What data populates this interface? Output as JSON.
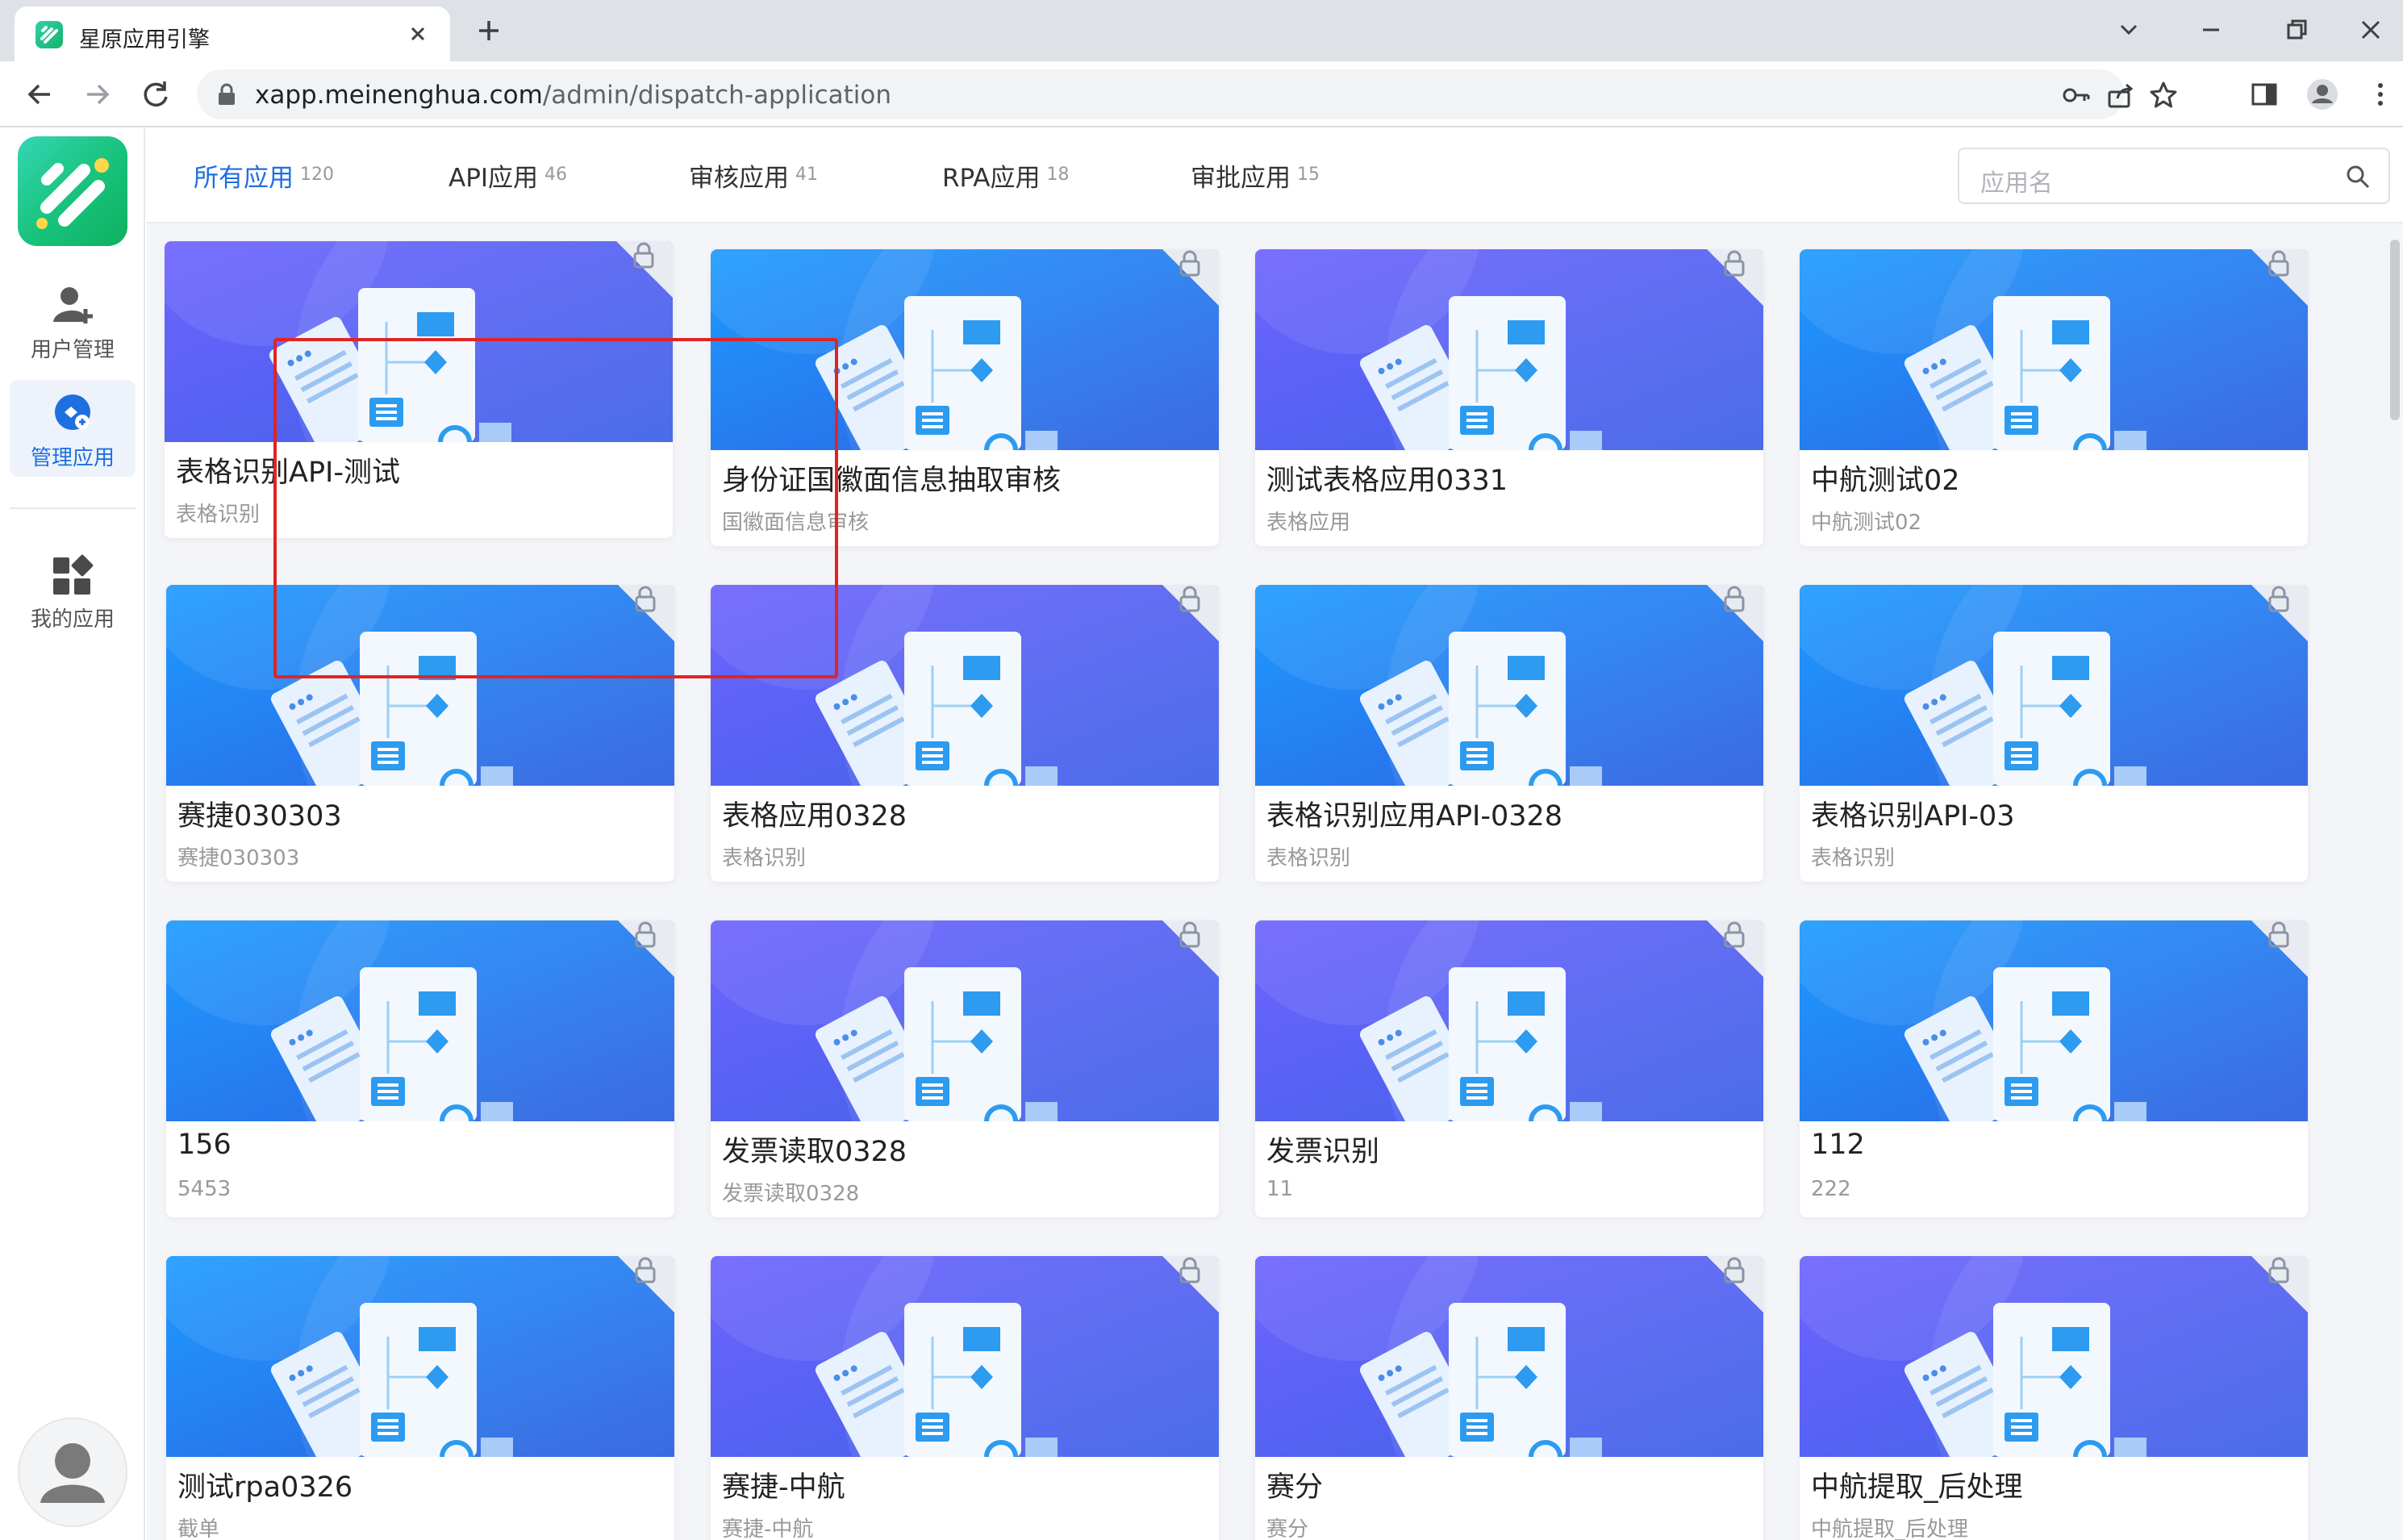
{
  "browser": {
    "tab_title": "星原应用引擎",
    "url_host": "xapp.meinenghua.com",
    "url_path": "/admin/dispatch-application"
  },
  "sidebar": {
    "items": [
      {
        "label": "用户管理",
        "icon": "add-user-icon",
        "active": false
      },
      {
        "label": "管理应用",
        "icon": "manage-app-icon",
        "active": true
      },
      {
        "label": "我的应用",
        "icon": "grid-apps-icon",
        "active": false
      }
    ]
  },
  "tabs": [
    {
      "label": "所有应用",
      "count": "120",
      "active": true
    },
    {
      "label": "API应用",
      "count": "46",
      "active": false
    },
    {
      "label": "审核应用",
      "count": "41",
      "active": false
    },
    {
      "label": "RPA应用",
      "count": "18",
      "active": false
    },
    {
      "label": "审批应用",
      "count": "15",
      "active": false
    }
  ],
  "search": {
    "placeholder": "应用名"
  },
  "cards": [
    {
      "name": "表格识别API-测试",
      "desc": "表格识别",
      "style": "purple"
    },
    {
      "name": "身份证国徽面信息抽取审核",
      "desc": "国徽面信息审核",
      "style": "blue"
    },
    {
      "name": "测试表格应用0331",
      "desc": "表格应用",
      "style": "purple"
    },
    {
      "name": "中航测试02",
      "desc": "中航测试02",
      "style": "blue"
    },
    {
      "name": "赛捷030303",
      "desc": "赛捷030303",
      "style": "blue"
    },
    {
      "name": "表格应用0328",
      "desc": "表格识别",
      "style": "purple"
    },
    {
      "name": "表格识别应用API-0328",
      "desc": "表格识别",
      "style": "blue"
    },
    {
      "name": "表格识别API-03",
      "desc": "表格识别",
      "style": "blue"
    },
    {
      "name": "156",
      "desc": "5453",
      "style": "blue"
    },
    {
      "name": "发票读取0328",
      "desc": "发票读取0328",
      "style": "purple"
    },
    {
      "name": "发票识别",
      "desc": "11",
      "style": "purple"
    },
    {
      "name": "112",
      "desc": "222",
      "style": "blue"
    },
    {
      "name": "测试rpa0326",
      "desc": "截单",
      "style": "blue"
    },
    {
      "name": "赛捷-中航",
      "desc": "赛捷-中航",
      "style": "purple"
    },
    {
      "name": "赛分",
      "desc": "赛分",
      "style": "purple"
    },
    {
      "name": "中航提取_后处理",
      "desc": "中航提取_后处理",
      "style": "purple"
    }
  ],
  "colors": {
    "accent": "#1e6fe0",
    "highlight": "#e02424",
    "banner_blue": "#1e90ff",
    "banner_purple": "#6a5cf0"
  }
}
